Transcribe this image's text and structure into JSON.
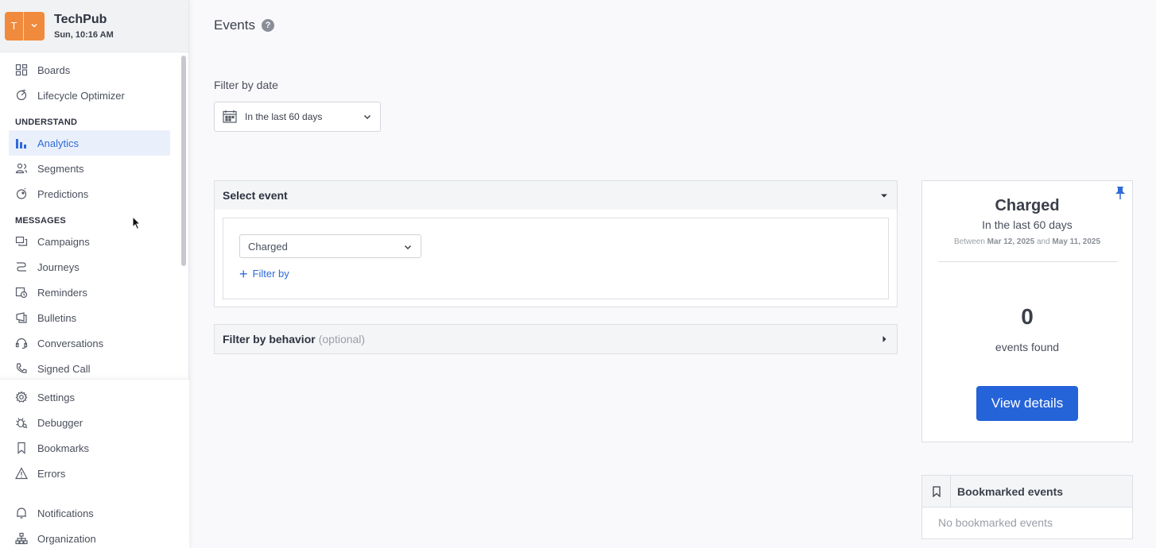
{
  "brand": {
    "initial": "T",
    "name": "TechPub",
    "time": "Sun, 10:16 AM"
  },
  "sidebar": {
    "top_items": [
      {
        "label": "Boards",
        "icon": "boards-icon"
      },
      {
        "label": "Lifecycle Optimizer",
        "icon": "lifecycle-icon"
      }
    ],
    "understand_header": "UNDERSTAND",
    "understand_items": [
      {
        "label": "Analytics",
        "icon": "bar-chart-icon",
        "active": true
      },
      {
        "label": "Segments",
        "icon": "users-icon"
      },
      {
        "label": "Predictions",
        "icon": "predictions-icon"
      }
    ],
    "messages_header": "MESSAGES",
    "messages_items": [
      {
        "label": "Campaigns",
        "icon": "campaigns-icon"
      },
      {
        "label": "Journeys",
        "icon": "journeys-icon"
      },
      {
        "label": "Reminders",
        "icon": "reminders-icon"
      },
      {
        "label": "Bulletins",
        "icon": "bulletins-icon"
      },
      {
        "label": "Conversations",
        "icon": "headset-icon"
      },
      {
        "label": "Signed Call",
        "icon": "phone-icon"
      }
    ],
    "bottom_items": [
      {
        "label": "Settings",
        "icon": "gear-icon"
      },
      {
        "label": "Debugger",
        "icon": "bug-icon"
      },
      {
        "label": "Bookmarks",
        "icon": "bookmark-icon"
      },
      {
        "label": "Errors",
        "icon": "warning-icon"
      },
      {
        "label": "Notifications",
        "icon": "bell-icon"
      },
      {
        "label": "Organization",
        "icon": "org-icon"
      }
    ]
  },
  "main": {
    "title": "Events",
    "filter_date_label": "Filter by date",
    "date_value": "In the last 60 days",
    "select_event_title": "Select event",
    "event_value": "Charged",
    "filter_by_label": "Filter by",
    "behavior_title": "Filter by behavior",
    "behavior_optional": "(optional)"
  },
  "summary": {
    "title": "Charged",
    "range": "In the last 60 days",
    "between_prefix": "Between",
    "start_date": "Mar 12, 2025",
    "and_word": "and",
    "end_date": "May 11, 2025",
    "count": "0",
    "found_label": "events found",
    "button_label": "View details"
  },
  "bookmarks": {
    "title": "Bookmarked events",
    "empty": "No bookmarked events"
  },
  "colors": {
    "accent": "#2563d9",
    "brand": "#f08a3c",
    "active_bg": "#eaf0fb"
  }
}
